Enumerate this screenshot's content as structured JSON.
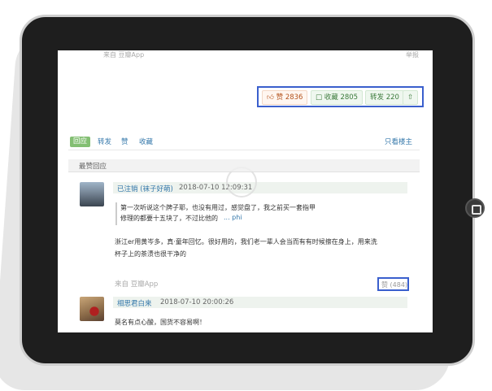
{
  "post": {
    "source_top": "来自 豆瓣App",
    "top_right": "举报"
  },
  "stats": {
    "like_label": "赞",
    "like_count": "2836",
    "collect_label": "收藏",
    "collect_count": "2805",
    "forward_label": "转发",
    "forward_count": "220"
  },
  "tabs": [
    "回应",
    "转发",
    "赞",
    "收藏"
  ],
  "only_op": "只看楼主",
  "section_title": "最赞回应",
  "comments": [
    {
      "author": "已注销 (袜子好萌)",
      "time": "2018-07-10 12:09:31",
      "quote_line1": "第一次听说这个牌子耶，也没有用过，感觉盘了，我之前买一套指甲",
      "quote_line2": "修理的都要十五块了，不过比他的",
      "quote_more": "... phi",
      "body_line1": "浙江er用黄岑多，真·童年回忆。很好用的，我们老一辈人会当而有有时候擦在身上，用来洗",
      "body_line2": "杯子上的茶渍也很干净的",
      "source": "来自 豆瓣App",
      "likes": "赞 (484)"
    },
    {
      "author": "相思君白来",
      "time": "2018-07-10 20:00:26",
      "body_line1": "莫名有点心酸，国货不容易啊！"
    }
  ],
  "colors": {
    "accent": "#3a5fcd",
    "link": "#3377aa",
    "tab_active": "#83bf73"
  }
}
